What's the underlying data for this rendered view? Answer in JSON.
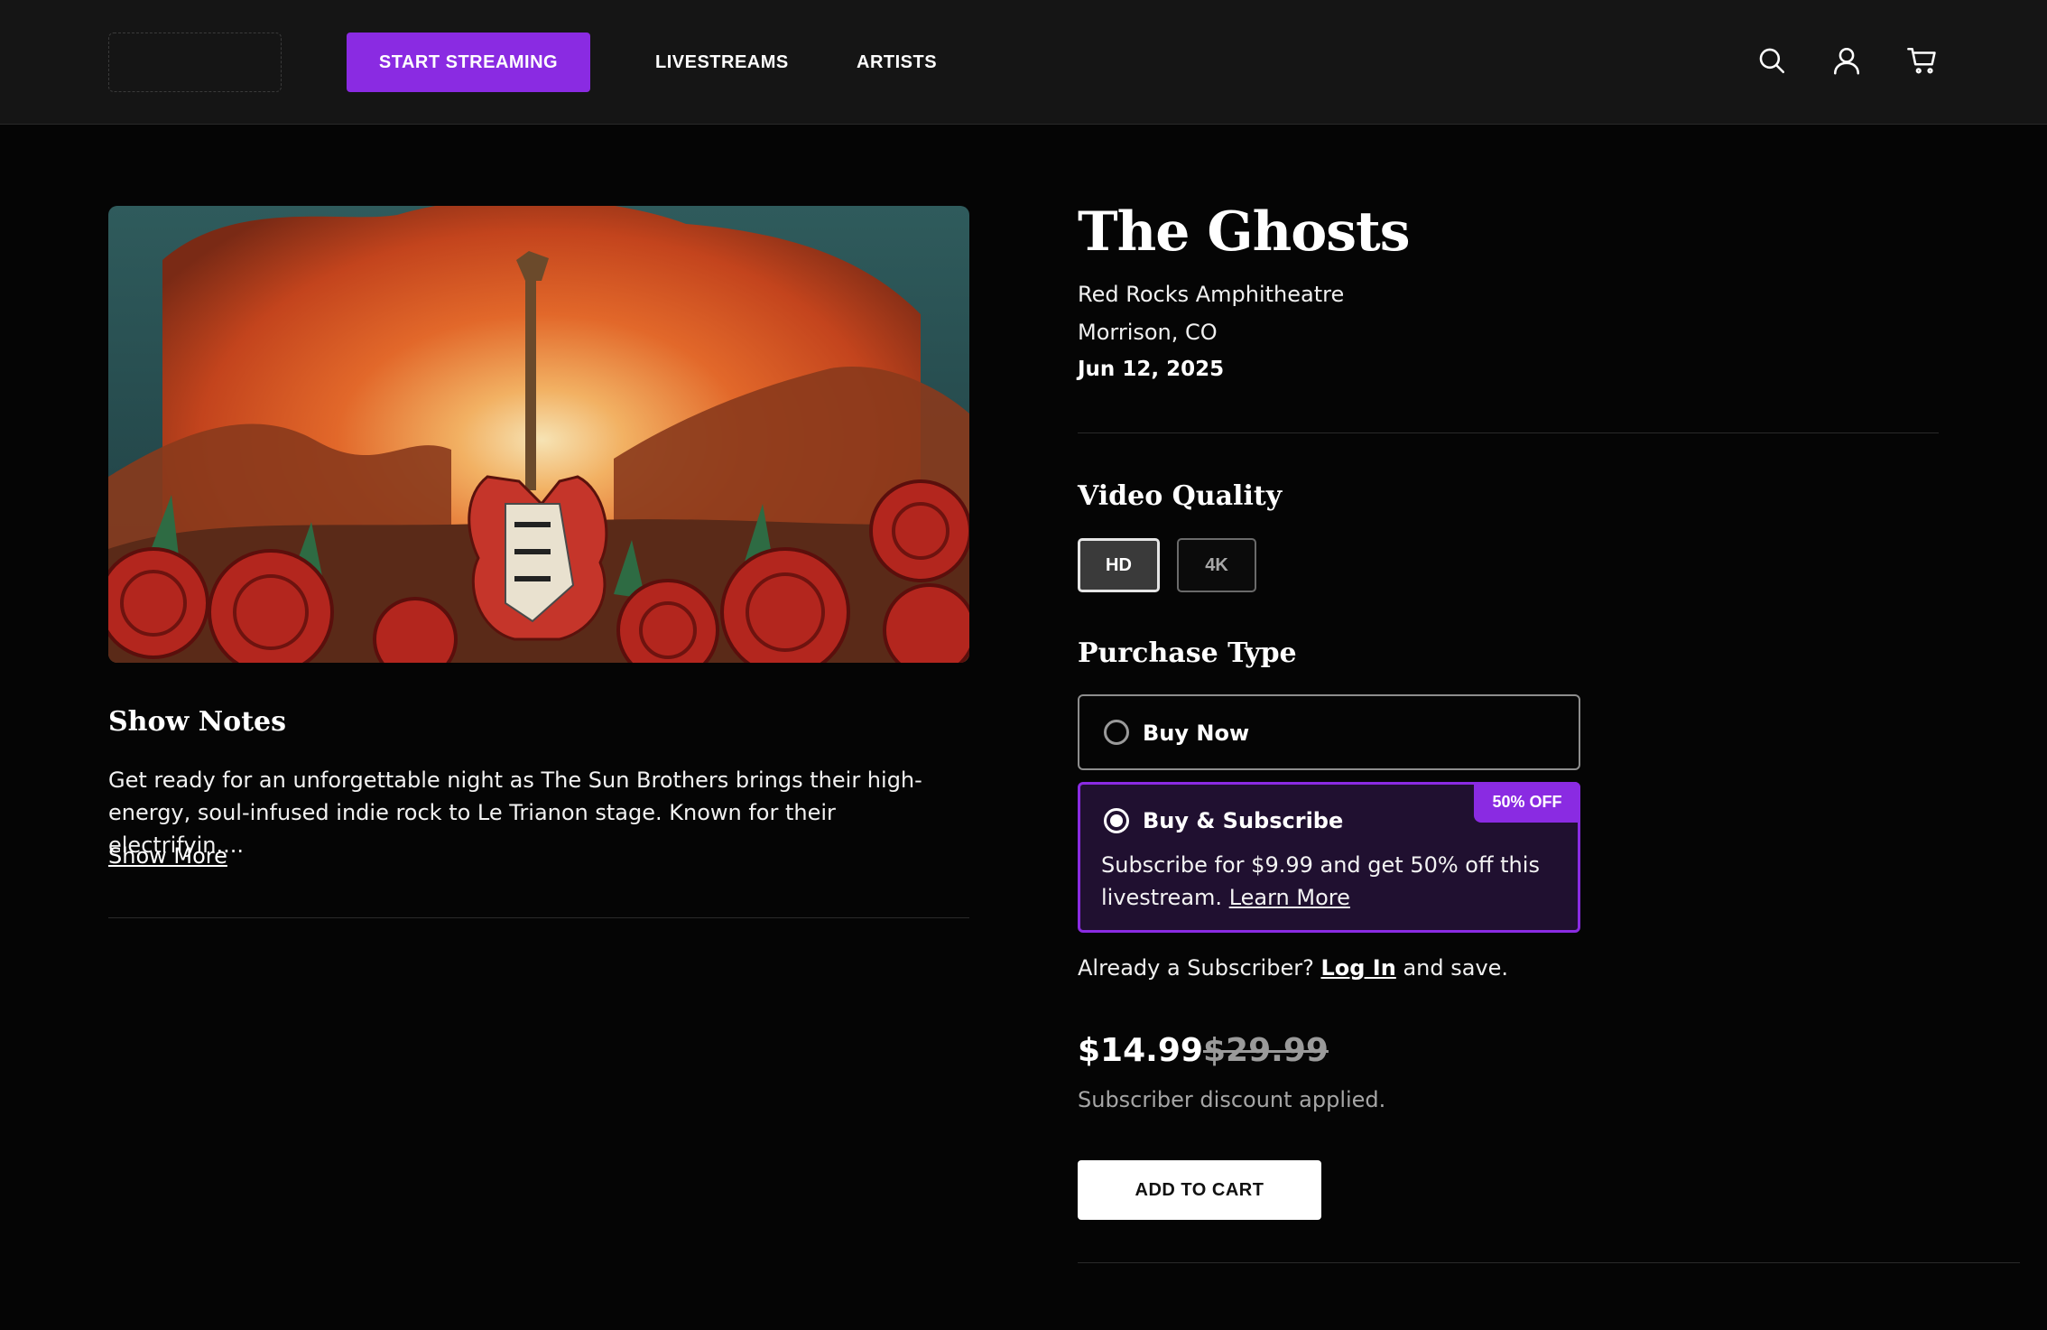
{
  "header": {
    "cta_label": "START STREAMING",
    "nav": [
      {
        "label": "LIVESTREAMS"
      },
      {
        "label": "ARTISTS"
      }
    ],
    "icons": [
      "search-icon",
      "user-icon",
      "cart-icon"
    ]
  },
  "show": {
    "title": "The Ghosts",
    "venue": "Red Rocks Amphitheatre",
    "location": "Morrison, CO",
    "date": "Jun 12, 2025"
  },
  "show_notes": {
    "title": "Show Notes",
    "text": "Get ready for an unforgettable night as The Sun Brothers brings their high-energy, soul-infused indie rock to Le Trianon stage. Known for their electrifyin....",
    "show_more": "Show More"
  },
  "video_quality": {
    "title": "Video Quality",
    "options": [
      {
        "label": "HD",
        "selected": true
      },
      {
        "label": "4K",
        "selected": false
      }
    ]
  },
  "purchase_type": {
    "title": "Purchase Type",
    "buy_now": {
      "label": "Buy Now",
      "selected": false
    },
    "buy_subscribe": {
      "label": "Buy & Subscribe",
      "selected": true,
      "badge": "50% OFF",
      "desc": "Subscribe for $9.99 and get 50% off this livestream.",
      "learn_more": "Learn More"
    }
  },
  "subscriber": {
    "prefix": "Already a Subscriber?",
    "login": "Log In",
    "suffix": "and save."
  },
  "pricing": {
    "price": "$14.99",
    "original": "$29.99",
    "note": "Subscriber discount applied."
  },
  "cart": {
    "add_label": "ADD TO CART"
  },
  "colors": {
    "accent": "#8a2be2",
    "background": "#050505",
    "header": "#151515"
  }
}
